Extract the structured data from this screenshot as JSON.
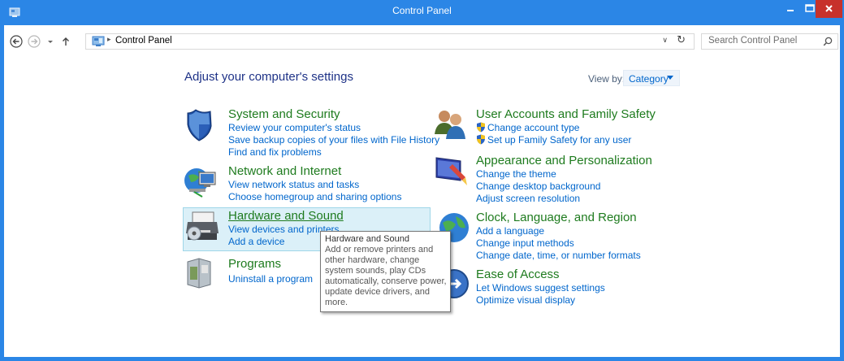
{
  "window": {
    "title": "Control Panel",
    "minimize": "–",
    "maximize": "☐",
    "close": "×"
  },
  "nav": {
    "back_icon": "back-arrow-icon",
    "forward_icon": "forward-arrow-icon",
    "recent_icon": "chevron-down-icon",
    "up_icon": "up-arrow-icon",
    "address_sep": "▸",
    "address": "Control Panel",
    "address_dropdown": "∨",
    "refresh": "↻",
    "search_placeholder": "Search Control Panel"
  },
  "main": {
    "heading": "Adjust your computer's settings",
    "view_by_label": "View by:",
    "view_by_value": "Category"
  },
  "categories": {
    "system_security": {
      "title": "System and Security",
      "links": [
        "Review your computer's status",
        "Save backup copies of your files with File History",
        "Find and fix problems"
      ]
    },
    "network_internet": {
      "title": "Network and Internet",
      "links": [
        "View network status and tasks",
        "Choose homegroup and sharing options"
      ]
    },
    "hardware_sound": {
      "title": "Hardware and Sound",
      "links": [
        "View devices and printers",
        "Add a device"
      ]
    },
    "programs": {
      "title": "Programs",
      "links": [
        "Uninstall a program"
      ]
    },
    "user_accounts": {
      "title": "User Accounts and Family Safety",
      "links": [
        "Change account type",
        "Set up Family Safety for any user"
      ]
    },
    "appearance": {
      "title": "Appearance and Personalization",
      "links": [
        "Change the theme",
        "Change desktop background",
        "Adjust screen resolution"
      ]
    },
    "clock_region": {
      "title": "Clock, Language, and Region",
      "links": [
        "Add a language",
        "Change input methods",
        "Change date, time, or number formats"
      ]
    },
    "ease_access": {
      "title": "Ease of Access",
      "links": [
        "Let Windows suggest settings",
        "Optimize visual display"
      ]
    }
  },
  "tooltip": {
    "title": "Hardware and Sound",
    "body": "Add or remove printers and other hardware, change system sounds, play CDs automatically, conserve power, update device drivers, and more."
  },
  "colors": {
    "titlebar": "#2b86e6",
    "close": "#c7312b",
    "link": "#0066cc",
    "category_title": "#1e7b1e",
    "heading": "#1e3287"
  }
}
